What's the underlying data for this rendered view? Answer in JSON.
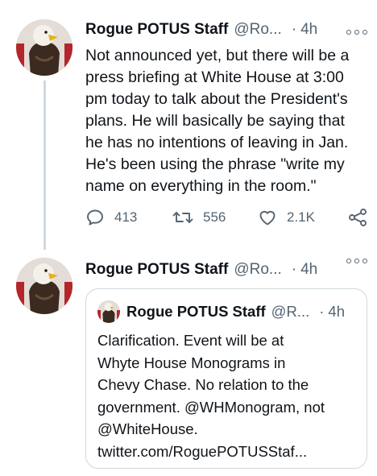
{
  "tweet1": {
    "author_name": "Rogue POTUS Staff",
    "handle": "@Ro...",
    "separator": "·",
    "time": "4h",
    "text": "Not announced yet, but there will be a\npress briefing at White House at 3:00\npm today to talk about the President's\nplans. He will basically be saying that\nhe has no intentions of leaving in Jan.\nHe's been using the phrase \"write my\nname on everything in the room.\"",
    "reply_count": "413",
    "retweet_count": "556",
    "like_count": "2.1K"
  },
  "tweet2": {
    "author_name": "Rogue POTUS Staff",
    "handle": "@Ro...",
    "separator": "·",
    "time": "4h",
    "quoted": {
      "author_name": "Rogue POTUS Staff",
      "handle": "@R...",
      "separator": "·",
      "time": "4h",
      "text": "Clarification. Event will be at\nWhyte House Monograms in\nChevy Chase. No relation to the\ngovernment. @WHMonogram, not\n@WhiteHouse.\ntwitter.com/RoguePOTUSStaf..."
    }
  },
  "icons": {
    "reply": "reply-icon",
    "retweet": "retweet-icon",
    "like": "heart-icon",
    "share": "share-icon",
    "more": "more-icon"
  },
  "colors": {
    "text": "#0f1419",
    "secondary": "#536471",
    "border": "#cfd9de",
    "background": "#ffffff"
  }
}
